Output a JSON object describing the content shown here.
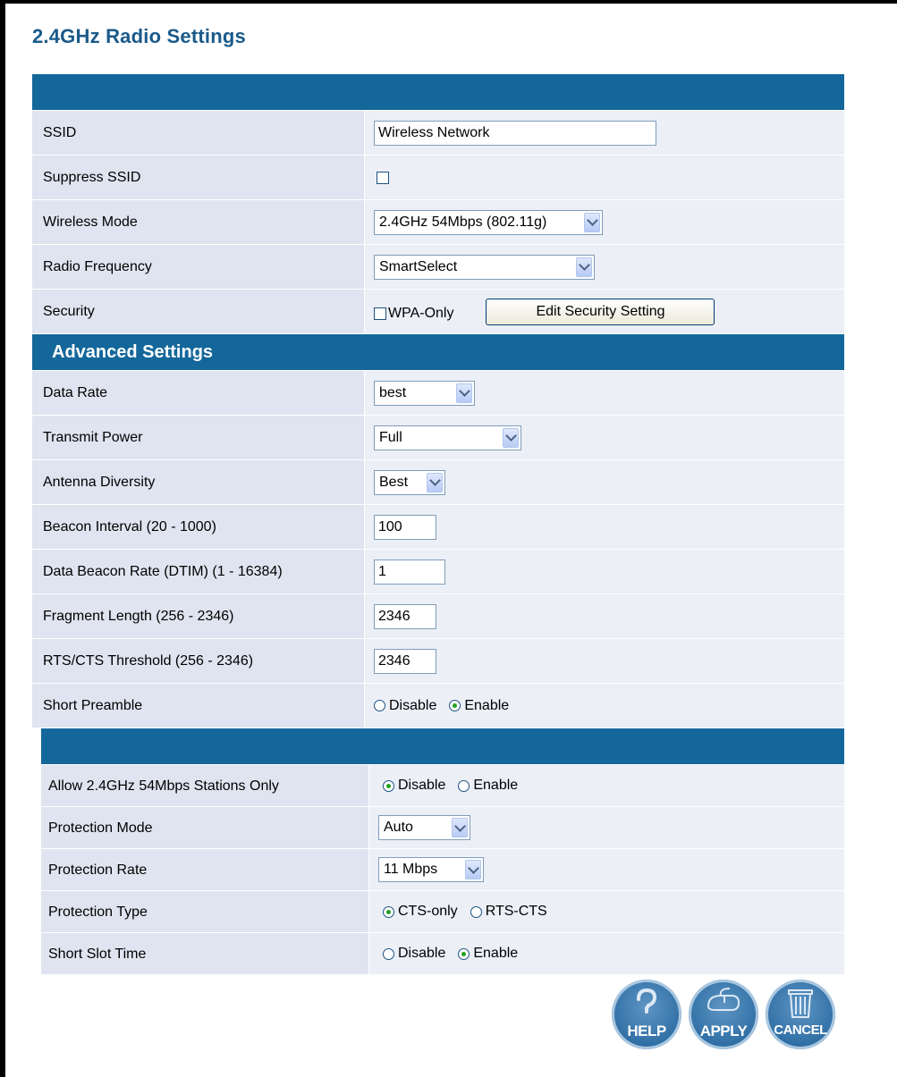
{
  "title": "2.4GHz Radio Settings",
  "basic": {
    "ssid": {
      "label": "SSID",
      "value": "Wireless Network"
    },
    "suppress_ssid": {
      "label": "Suppress SSID",
      "checked": false
    },
    "wireless_mode": {
      "label": "Wireless Mode",
      "value": "2.4GHz 54Mbps (802.11g)"
    },
    "radio_frequency": {
      "label": "Radio Frequency",
      "value": "SmartSelect"
    },
    "security": {
      "label": "Security",
      "wpa_only_label": "WPA-Only",
      "wpa_only_checked": false,
      "edit_button": "Edit Security Setting"
    }
  },
  "advanced": {
    "heading": "Advanced Settings",
    "data_rate": {
      "label": "Data Rate",
      "value": "best"
    },
    "transmit_power": {
      "label": "Transmit Power",
      "value": "Full"
    },
    "antenna_diversity": {
      "label": "Antenna Diversity",
      "value": "Best"
    },
    "beacon_interval": {
      "label": "Beacon Interval (20 - 1000)",
      "value": "100"
    },
    "dtim": {
      "label": "Data Beacon Rate (DTIM) (1 - 16384)",
      "value": "1"
    },
    "fragment_length": {
      "label": "Fragment Length (256 - 2346)",
      "value": "2346"
    },
    "rts_threshold": {
      "label": "RTS/CTS Threshold (256 - 2346)",
      "value": "2346"
    },
    "short_preamble": {
      "label": "Short Preamble",
      "options": [
        "Disable",
        "Enable"
      ],
      "selected": "Enable"
    }
  },
  "protection": {
    "allow_54": {
      "label": "Allow 2.4GHz 54Mbps Stations Only",
      "options": [
        "Disable",
        "Enable"
      ],
      "selected": "Disable"
    },
    "protection_mode": {
      "label": "Protection Mode",
      "value": "Auto"
    },
    "protection_rate": {
      "label": "Protection Rate",
      "value": "11 Mbps"
    },
    "protection_type": {
      "label": "Protection Type",
      "options": [
        "CTS-only",
        "RTS-CTS"
      ],
      "selected": "CTS-only"
    },
    "short_slot_time": {
      "label": "Short Slot Time",
      "options": [
        "Disable",
        "Enable"
      ],
      "selected": "Enable"
    }
  },
  "buttons": {
    "help": "HELP",
    "apply": "APPLY",
    "cancel": "CANCEL"
  },
  "icons": {
    "help": "question-mark-icon",
    "apply": "mouse-icon",
    "cancel": "trash-can-icon",
    "select_arrow": "chevron-down-icon"
  },
  "colors": {
    "header_bar": "#14679a",
    "title": "#1a5a8a",
    "label_bg": "#dfe4f0",
    "value_bg": "#eceff6",
    "radio_selected": "#21a121"
  }
}
